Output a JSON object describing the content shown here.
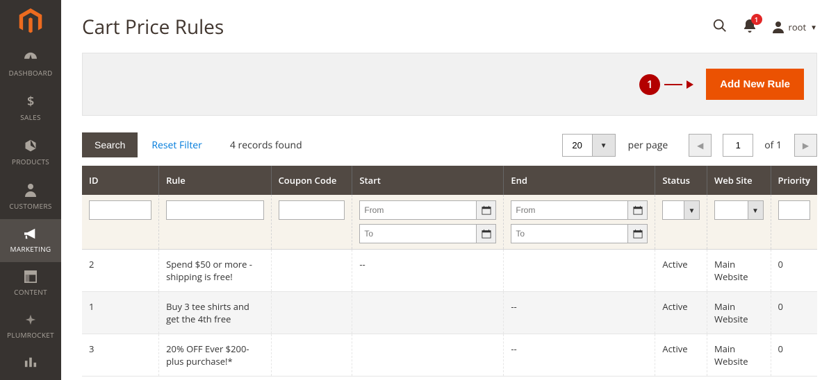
{
  "page": {
    "title": "Cart Price Rules"
  },
  "header": {
    "notification_count": "1",
    "username": "root"
  },
  "sidebar": {
    "items": [
      {
        "label": "DASHBOARD"
      },
      {
        "label": "SALES"
      },
      {
        "label": "PRODUCTS"
      },
      {
        "label": "CUSTOMERS"
      },
      {
        "label": "MARKETING"
      },
      {
        "label": "CONTENT"
      },
      {
        "label": "PLUMROCKET"
      },
      {
        "label": ""
      }
    ]
  },
  "callout": {
    "number": "1"
  },
  "actions": {
    "add_new_rule": "Add New Rule"
  },
  "controls": {
    "search": "Search",
    "reset": "Reset Filter",
    "records": "4 records found",
    "per_page_value": "20",
    "per_page_label": "per page",
    "page_value": "1",
    "of_label": "of 1"
  },
  "columns": {
    "id": "ID",
    "rule": "Rule",
    "coupon": "Coupon Code",
    "start": "Start",
    "end": "End",
    "status": "Status",
    "web": "Web Site",
    "priority": "Priority"
  },
  "filters": {
    "from": "From",
    "to": "To"
  },
  "rows": [
    {
      "id": "2",
      "rule": "Spend $50 or more - shipping is free!",
      "coupon": "",
      "start": "--",
      "end": "",
      "status": "Active",
      "web": "Main Website",
      "priority": "0"
    },
    {
      "id": "1",
      "rule": "Buy 3 tee shirts and get the 4th free",
      "coupon": "",
      "start": "",
      "end": "--",
      "status": "Active",
      "web": "Main Website",
      "priority": "0"
    },
    {
      "id": "3",
      "rule": "20% OFF Ever $200-plus purchase!*",
      "coupon": "",
      "start": "",
      "end": "--",
      "status": "Active",
      "web": "Main Website",
      "priority": "0"
    }
  ]
}
